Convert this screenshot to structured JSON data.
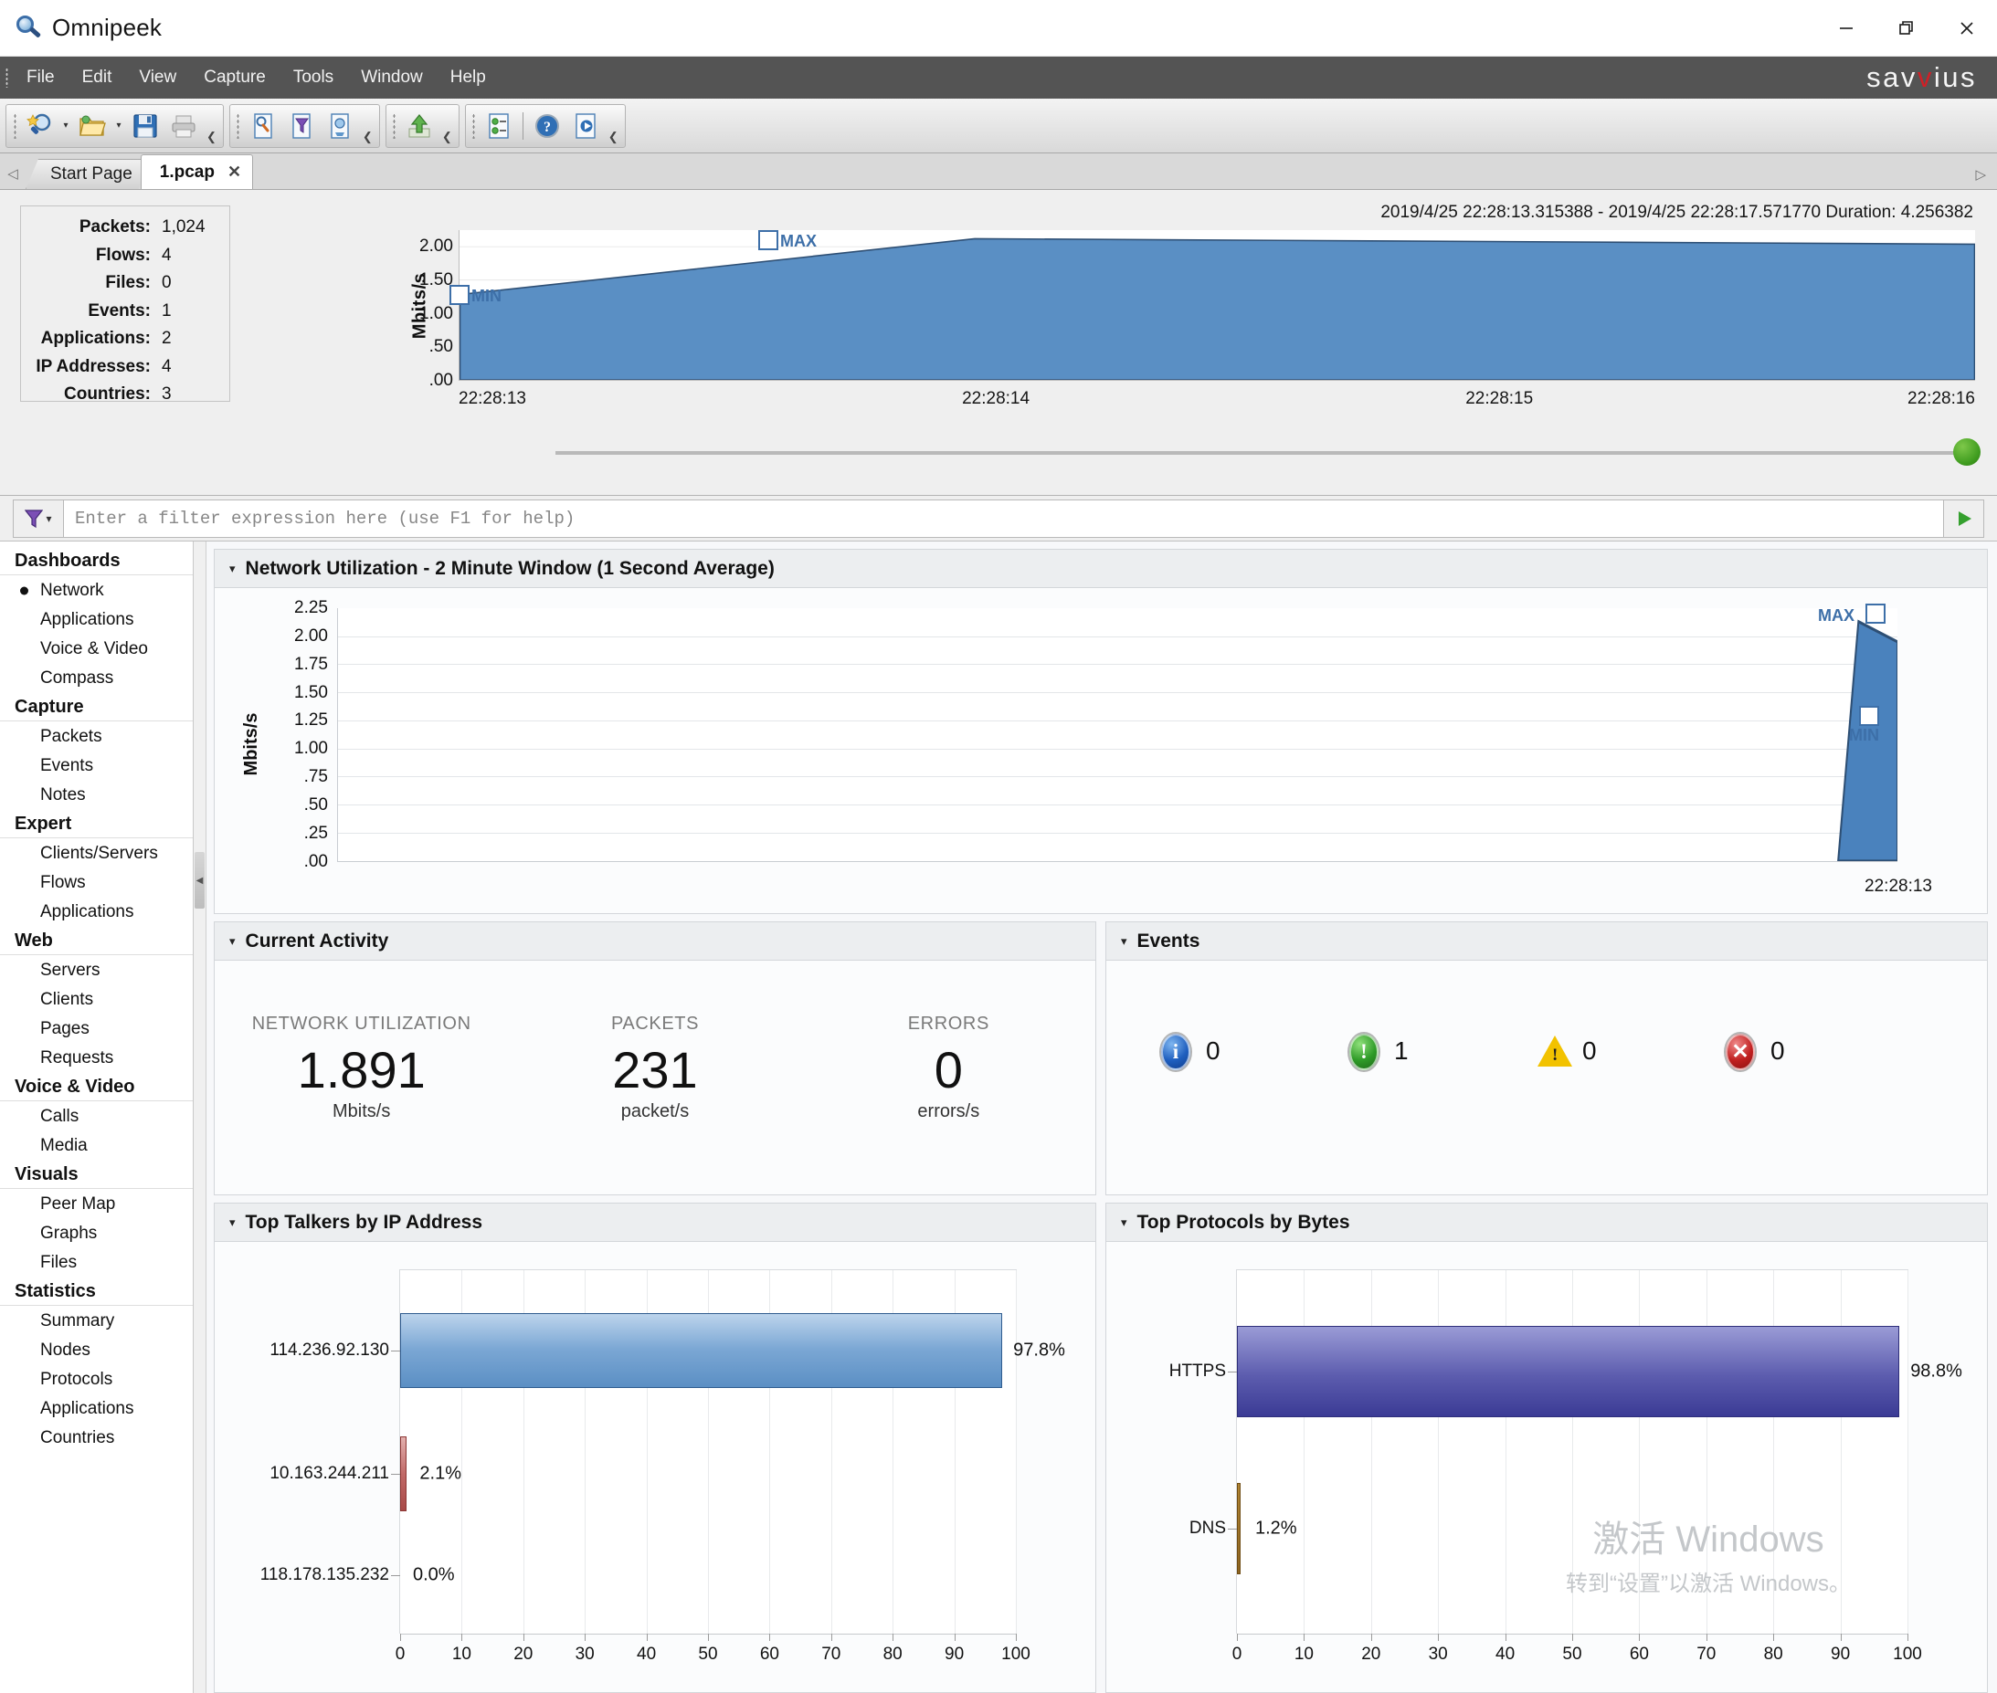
{
  "window": {
    "title": "Omnipeek",
    "app_icon": "magnifier-icon",
    "minimize": "—",
    "maximize": "❐",
    "close": "✕"
  },
  "brand": {
    "pre": "sav",
    "v": "v",
    "post": "ius"
  },
  "menu": [
    "File",
    "Edit",
    "View",
    "Capture",
    "Tools",
    "Window",
    "Help"
  ],
  "toolbar": {
    "groups": [
      {
        "buttons": [
          {
            "name": "new-capture-icon",
            "caret": true
          },
          {
            "name": "open-file-icon",
            "caret": true
          },
          {
            "name": "save-icon",
            "caret": false
          },
          {
            "name": "print-icon",
            "caret": false
          }
        ]
      },
      {
        "buttons": [
          {
            "name": "packet-decode-icon",
            "caret": false
          },
          {
            "name": "filter-icon",
            "caret": false
          },
          {
            "name": "capture-options-icon",
            "caret": false
          }
        ]
      },
      {
        "buttons": [
          {
            "name": "upload-icon",
            "caret": false
          }
        ]
      },
      {
        "buttons": [
          {
            "name": "select-related-icon",
            "caret": false
          },
          {
            "name": "help-icon",
            "caret": false
          },
          {
            "name": "about-icon",
            "caret": false
          }
        ]
      }
    ],
    "overflow_glyph": "⸎"
  },
  "tabs": {
    "prev_glyph": "◁",
    "next_glyph": "▷",
    "items": [
      {
        "label": "Start Page",
        "active": false,
        "closable": false
      },
      {
        "label": "1.pcap",
        "active": true,
        "closable": true,
        "close_glyph": "✕"
      }
    ]
  },
  "summary": {
    "rows": [
      {
        "label": "Packets:",
        "value": "1,024"
      },
      {
        "label": "Flows:",
        "value": "4"
      },
      {
        "label": "Files:",
        "value": "0"
      },
      {
        "label": "Events:",
        "value": "1"
      },
      {
        "label": "Applications:",
        "value": "2"
      },
      {
        "label": "IP Addresses:",
        "value": "4"
      },
      {
        "label": "Countries:",
        "value": "3"
      }
    ]
  },
  "timeline": {
    "timestamp_range": "2019/4/25 22:28:13.315388 - 2019/4/25 22:28:17.571770  Duration: 4.256382",
    "min_marker": "MIN",
    "max_marker": "MAX"
  },
  "filter": {
    "placeholder": "Enter a filter expression here (use F1 for help)",
    "value": "",
    "funnel_icon": "funnel-icon",
    "dropdown_glyph": "▾",
    "run_glyph": "▶"
  },
  "sidebar": {
    "sections": [
      {
        "header": "Dashboards",
        "items": [
          {
            "label": "Network",
            "selected": true
          },
          {
            "label": "Applications",
            "selected": false
          },
          {
            "label": "Voice & Video",
            "selected": false
          },
          {
            "label": "Compass",
            "selected": false
          }
        ]
      },
      {
        "header": "Capture",
        "items": [
          {
            "label": "Packets",
            "selected": false
          },
          {
            "label": "Events",
            "selected": false
          },
          {
            "label": "Notes",
            "selected": false
          }
        ]
      },
      {
        "header": "Expert",
        "items": [
          {
            "label": "Clients/Servers",
            "selected": false
          },
          {
            "label": "Flows",
            "selected": false
          },
          {
            "label": "Applications",
            "selected": false
          }
        ]
      },
      {
        "header": "Web",
        "items": [
          {
            "label": "Servers",
            "selected": false
          },
          {
            "label": "Clients",
            "selected": false
          },
          {
            "label": "Pages",
            "selected": false
          },
          {
            "label": "Requests",
            "selected": false
          }
        ]
      },
      {
        "header": "Voice & Video",
        "items": [
          {
            "label": "Calls",
            "selected": false
          },
          {
            "label": "Media",
            "selected": false
          }
        ]
      },
      {
        "header": "Visuals",
        "items": [
          {
            "label": "Peer Map",
            "selected": false
          },
          {
            "label": "Graphs",
            "selected": false
          },
          {
            "label": "Files",
            "selected": false
          }
        ]
      },
      {
        "header": "Statistics",
        "items": [
          {
            "label": "Summary",
            "selected": false
          },
          {
            "label": "Nodes",
            "selected": false
          },
          {
            "label": "Protocols",
            "selected": false
          },
          {
            "label": "Applications",
            "selected": false
          },
          {
            "label": "Countries",
            "selected": false
          }
        ]
      }
    ]
  },
  "panels": {
    "network_utilization": {
      "title": "Network Utilization - 2 Minute Window (1 Second Average)",
      "caret": "▾"
    },
    "current_activity": {
      "title": "Current Activity",
      "caret": "▾"
    },
    "events": {
      "title": "Events",
      "caret": "▾"
    },
    "top_talkers": {
      "title": "Top Talkers by IP Address",
      "caret": "▾"
    },
    "top_protocols": {
      "title": "Top Protocols by Bytes",
      "caret": "▾"
    }
  },
  "current_activity": {
    "metrics": [
      {
        "label": "NETWORK UTILIZATION",
        "value": "1.891",
        "unit": "Mbits/s"
      },
      {
        "label": "PACKETS",
        "value": "231",
        "unit": "packet/s"
      },
      {
        "label": "ERRORS",
        "value": "0",
        "unit": "errors/s"
      }
    ]
  },
  "events_counts": [
    {
      "severity": "informational",
      "icon": "info-circle-icon",
      "glyph": "i",
      "count": "0",
      "color": "#1f5fbf"
    },
    {
      "severity": "minor",
      "icon": "exclamation-circle-green-icon",
      "glyph": "!",
      "count": "1",
      "color": "#2f9b28"
    },
    {
      "severity": "major",
      "icon": "warning-triangle-icon",
      "glyph": "!",
      "count": "0",
      "color": "#f2c200"
    },
    {
      "severity": "severe",
      "icon": "error-circle-icon",
      "glyph": "✕",
      "count": "0",
      "color": "#c01f1f"
    }
  ],
  "watermark": {
    "line1": "激活 Windows",
    "line2": "转到“设置”以激活 Windows。"
  },
  "chart_data": [
    {
      "type": "area",
      "name": "timeline-overview",
      "title": "",
      "ylabel": "Mbits/s",
      "yticks": [
        "2.00",
        "1.50",
        "1.00",
        ".50",
        ".00"
      ],
      "ytickvals": [
        2.0,
        1.5,
        1.0,
        0.5,
        0.0
      ],
      "ylim": [
        0,
        2.25
      ],
      "xticks": [
        "22:28:13",
        "22:28:14",
        "22:28:15",
        "22:28:16"
      ],
      "x": [
        0,
        0.34,
        1.0
      ],
      "values": [
        1.27,
        2.13,
        2.05
      ],
      "markers": [
        {
          "label": "MIN",
          "x": 0.0,
          "y": 1.27
        },
        {
          "label": "MAX",
          "x": 0.34,
          "y": 2.13
        }
      ],
      "grid": true,
      "fill_color": "#5a8fc4"
    },
    {
      "type": "area",
      "name": "network-utilization",
      "title": "Network Utilization - 2 Minute Window (1 Second Average)",
      "ylabel": "Mbits/s",
      "yticks": [
        "2.25",
        "2.00",
        "1.75",
        "1.50",
        "1.25",
        "1.00",
        ".75",
        ".50",
        ".25",
        ".00"
      ],
      "ytickvals": [
        2.25,
        2.0,
        1.75,
        1.5,
        1.25,
        1.0,
        0.75,
        0.5,
        0.25,
        0.0
      ],
      "ylim": [
        0,
        2.25
      ],
      "xticks": [
        "22:28:13"
      ],
      "x": [
        0.962,
        0.975,
        1.0
      ],
      "values": [
        0.0,
        2.13,
        1.95
      ],
      "markers": [
        {
          "label": "MAX",
          "x": 0.975,
          "y": 2.13
        },
        {
          "label": "MIN",
          "x": 0.975,
          "y": 1.27
        }
      ],
      "grid": true,
      "fill_color": "#4a82bd"
    },
    {
      "type": "bar",
      "name": "top-talkers-by-ip-address",
      "title": "Top Talkers by IP Address",
      "orientation": "horizontal",
      "categories": [
        "114.236.92.130",
        "10.163.244.211",
        "118.178.135.232"
      ],
      "values": [
        97.8,
        2.1,
        0.0
      ],
      "value_labels": [
        "97.8%",
        "2.1%",
        "0.0%"
      ],
      "colors": [
        "#7ba7d4",
        "#c16a68",
        "#c16a68"
      ],
      "xlabel": "",
      "ylabel": "",
      "xlim": [
        0,
        100
      ],
      "xticks": [
        0,
        10,
        20,
        30,
        40,
        50,
        60,
        70,
        80,
        90,
        100
      ],
      "grid": true
    },
    {
      "type": "bar",
      "name": "top-protocols-by-bytes",
      "title": "Top Protocols by Bytes",
      "orientation": "horizontal",
      "categories": [
        "HTTPS",
        "DNS"
      ],
      "values": [
        98.8,
        1.2
      ],
      "value_labels": [
        "98.8%",
        "1.2%"
      ],
      "colors": [
        "#5c5cae",
        "#8d6420"
      ],
      "xlabel": "",
      "ylabel": "",
      "xlim": [
        0,
        100
      ],
      "xticks": [
        0,
        10,
        20,
        30,
        40,
        50,
        60,
        70,
        80,
        90,
        100
      ],
      "grid": true
    }
  ]
}
